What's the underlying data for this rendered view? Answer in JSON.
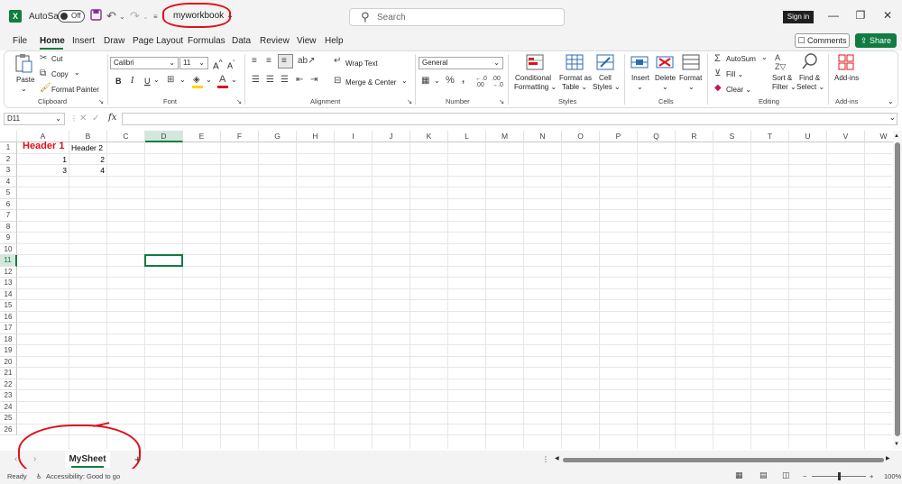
{
  "title_bar": {
    "autosave_label": "AutoSave",
    "autosave_state": "Off",
    "file_name": "myworkbook",
    "search_placeholder": "Search",
    "sign_in": "Sign in"
  },
  "menu_tabs": [
    "File",
    "Home",
    "Insert",
    "Draw",
    "Page Layout",
    "Formulas",
    "Data",
    "Review",
    "View",
    "Help"
  ],
  "active_tab": "Home",
  "comments_label": "Comments",
  "share_label": "Share",
  "ribbon": {
    "clipboard": {
      "paste": "Paste",
      "cut": "Cut",
      "copy": "Copy",
      "format_painter": "Format Painter",
      "label": "Clipboard"
    },
    "font": {
      "name": "Calibri",
      "size": "11",
      "bold": "B",
      "italic": "I",
      "underline": "U",
      "label": "Font"
    },
    "alignment": {
      "wrap": "Wrap Text",
      "merge": "Merge & Center",
      "label": "Alignment"
    },
    "number": {
      "format": "General",
      "label": "Number"
    },
    "styles": {
      "conditional": "Conditional",
      "conditional2": "Formatting",
      "format_table": "Format as",
      "format_table2": "Table",
      "cell_styles": "Cell",
      "cell_styles2": "Styles",
      "label": "Styles"
    },
    "cells": {
      "insert": "Insert",
      "delete": "Delete",
      "format": "Format",
      "label": "Cells"
    },
    "editing": {
      "autosum": "AutoSum",
      "fill": "Fill",
      "clear": "Clear",
      "sort": "Sort &",
      "sort2": "Filter",
      "find": "Find &",
      "find2": "Select",
      "label": "Editing"
    },
    "addins": {
      "label": "Add-ins",
      "group": "Add-ins"
    }
  },
  "name_box": "D11",
  "fx": "fx",
  "columns": [
    "A",
    "B",
    "C",
    "D",
    "E",
    "F",
    "G",
    "H",
    "I",
    "J",
    "K",
    "L",
    "M",
    "N",
    "O",
    "P",
    "Q",
    "R",
    "S",
    "T",
    "U",
    "V",
    "W"
  ],
  "rows": [
    "1",
    "2",
    "3",
    "4",
    "5",
    "6",
    "7",
    "8",
    "9",
    "10",
    "11",
    "12",
    "13",
    "14",
    "15",
    "16",
    "17",
    "18",
    "19",
    "20",
    "21",
    "22",
    "23",
    "24",
    "25",
    "26"
  ],
  "cells": {
    "A1": "Header 1",
    "B1": "Header 2",
    "A2": "1",
    "B2": "2",
    "A3": "3",
    "B3": "4"
  },
  "header_color": "#e0101a",
  "accent_color": "#107c41",
  "sheet_tab": "MySheet",
  "add_sheet": "+",
  "status": {
    "ready": "Ready",
    "accessibility": "Accessibility: Good to go",
    "zoom": "100%"
  }
}
